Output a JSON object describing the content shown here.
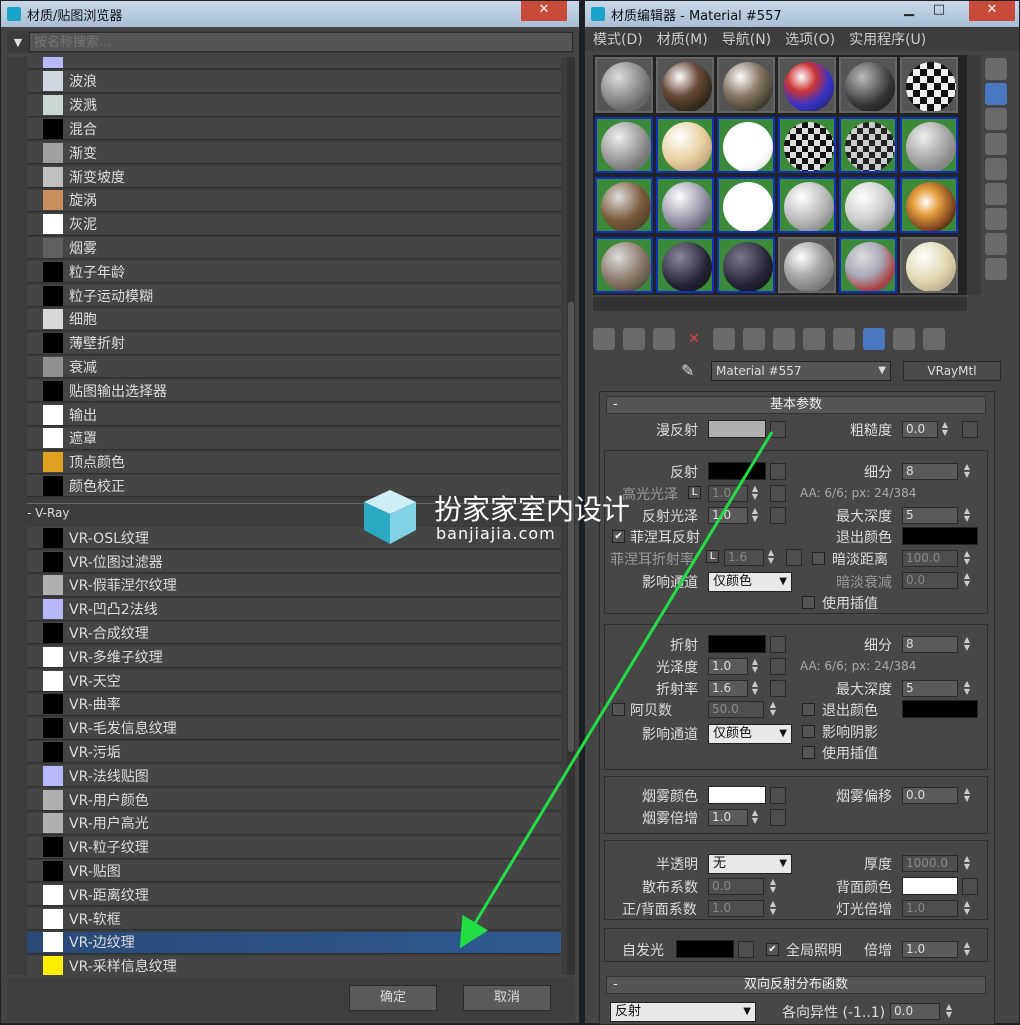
{
  "left_window": {
    "title": "材质/贴图浏览器",
    "close_label": "✕",
    "search_placeholder": "按名称搜索...",
    "items_top": [
      {
        "label": "",
        "color": "#b8b8ff"
      },
      {
        "label": "波浪",
        "color": "#cfd8e0"
      },
      {
        "label": "泼溅",
        "color": "#c8d8d0"
      },
      {
        "label": "混合",
        "color": "#000000"
      },
      {
        "label": "渐变",
        "color": "#a0a0a0"
      },
      {
        "label": "渐变坡度",
        "color": "#c0c0c0"
      },
      {
        "label": "旋涡",
        "color": "#c89060"
      },
      {
        "label": "灰泥",
        "color": "#ffffff"
      },
      {
        "label": "烟雾",
        "color": "#606060"
      },
      {
        "label": "粒子年龄",
        "color": "#000000"
      },
      {
        "label": "粒子运动模糊",
        "color": "#000000"
      },
      {
        "label": "细胞",
        "color": "#d8d8d8"
      },
      {
        "label": "薄壁折射",
        "color": "#000000"
      },
      {
        "label": "衰减",
        "color": "#909090"
      },
      {
        "label": "贴图输出选择器",
        "color": "#000000"
      },
      {
        "label": "输出",
        "color": "#ffffff"
      },
      {
        "label": "遮罩",
        "color": "#ffffff"
      },
      {
        "label": "顶点颜色",
        "color": "#e0a020"
      },
      {
        "label": "颜色校正",
        "color": "#000000"
      }
    ],
    "group_vray": "- V-Ray",
    "items_vray": [
      {
        "label": "VR-OSL纹理",
        "color": "#000000"
      },
      {
        "label": "VR-位图过滤器",
        "color": "#000000"
      },
      {
        "label": "VR-假菲涅尔纹理",
        "color": "#b0b0b0"
      },
      {
        "label": "VR-凹凸2法线",
        "color": "#b8b8ff"
      },
      {
        "label": "VR-合成纹理",
        "color": "#000000"
      },
      {
        "label": "VR-多维子纹理",
        "color": "#ffffff"
      },
      {
        "label": "VR-天空",
        "color": "#ffffff"
      },
      {
        "label": "VR-曲率",
        "color": "#000000"
      },
      {
        "label": "VR-毛发信息纹理",
        "color": "#000000"
      },
      {
        "label": "VR-污垢",
        "color": "#000000"
      },
      {
        "label": "VR-法线贴图",
        "color": "#b8b8ff"
      },
      {
        "label": "VR-用户颜色",
        "color": "#b0b0b0"
      },
      {
        "label": "VR-用户高光",
        "color": "#b0b0b0"
      },
      {
        "label": "VR-粒子纹理",
        "color": "#000000"
      },
      {
        "label": "VR-贴图",
        "color": "#000000"
      },
      {
        "label": "VR-距离纹理",
        "color": "#ffffff"
      },
      {
        "label": "VR-软框",
        "color": "#ffffff"
      },
      {
        "label": "VR-边纹理",
        "color": "#ffffff",
        "selected": true
      },
      {
        "label": "VR-采样信息纹理",
        "color": "#ffee00"
      }
    ],
    "ok_label": "确定",
    "cancel_label": "取消"
  },
  "right_window": {
    "title": "材质编辑器 - Material #557",
    "minimize": "▁",
    "maximize": "□",
    "close": "✕",
    "menu": [
      "模式(D)",
      "材质(M)",
      "导航(N)",
      "选项(O)",
      "实用程序(U)"
    ],
    "material_name": "Material #557",
    "material_type": "VRayMtl",
    "rollout_basic": "基本参数",
    "diffuse_label": "漫反射",
    "roughness_label": "粗糙度",
    "roughness_value": "0.0",
    "reflect_label": "反射",
    "subdiv_label": "细分",
    "reflect_subdiv": "8",
    "hilight_gloss_label": "高光光泽",
    "hilight_gloss_value": "1.0",
    "lock_label": "L",
    "aa_stat": "AA: 6/6; px: 24/384",
    "refl_gloss_label": "反射光泽",
    "refl_gloss_value": "1.0",
    "max_depth_label": "最大深度",
    "refl_max_depth": "5",
    "fresnel_label": "菲涅耳反射",
    "exit_color_label": "退出颜色",
    "fresnel_ior_label": "菲涅耳折射率",
    "fresnel_ior_value": "1.6",
    "dim_distance_label": "暗淡距离",
    "dim_distance_value": "100.0",
    "affect_channels_label": "影响通道",
    "affect_channels_value": "仅颜色",
    "dim_falloff_label": "暗淡衰减",
    "dim_falloff_value": "0.0",
    "use_interp_label": "使用插值",
    "refract_label": "折射",
    "refract_subdiv": "8",
    "gloss_label": "光泽度",
    "gloss_value": "1.0",
    "ior_label": "折射率",
    "ior_value": "1.6",
    "refr_max_depth": "5",
    "abbe_label": "阿贝数",
    "abbe_value": "50.0",
    "affect_shadows_label": "影响阴影",
    "fog_color_label": "烟雾颜色",
    "fog_bias_label": "烟雾偏移",
    "fog_bias_value": "0.0",
    "fog_mult_label": "烟雾倍增",
    "fog_mult_value": "1.0",
    "translucency_label": "半透明",
    "translucency_value": "无",
    "thickness_label": "厚度",
    "thickness_value": "1000.0",
    "scatter_label": "散布系数",
    "scatter_value": "0.0",
    "back_color_label": "背面颜色",
    "fwd_back_label": "正/背面系数",
    "fwd_back_value": "1.0",
    "light_mult_label": "灯光倍增",
    "light_mult_value": "1.0",
    "self_illum_label": "自发光",
    "gi_label": "全局照明",
    "mult_label": "倍增",
    "mult_value": "1.0",
    "rollout_brdf": "双向反射分布函数",
    "brdf_type": "反射",
    "anisotropy_label": "各向异性 (-1..1)",
    "anisotropy_value": "0.0"
  },
  "watermark": {
    "title": "扮家家室内设计",
    "url": "banjiajia.com"
  },
  "colors": {
    "bg": "#444444",
    "selected": "#2e5a90",
    "accent_arrow": "#22dd44"
  }
}
